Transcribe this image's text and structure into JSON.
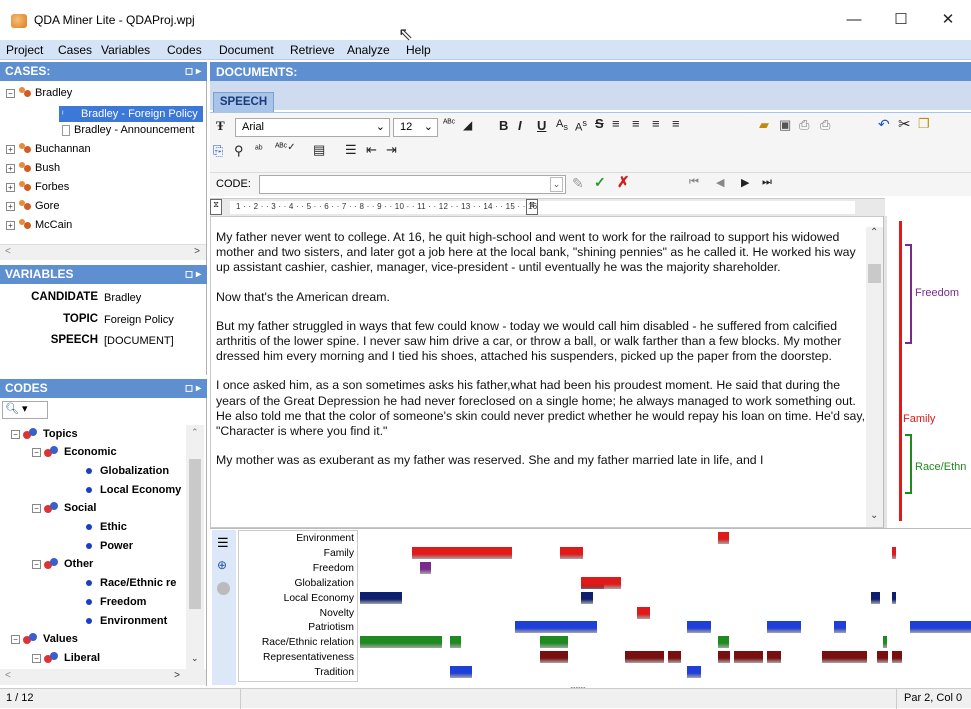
{
  "window": {
    "title": "QDA Miner Lite - QDAProj.wpj",
    "minimize": "—",
    "maximize": "☐",
    "close": "✕"
  },
  "menu": [
    "Project",
    "Cases",
    "Variables",
    "Codes",
    "Document",
    "Retrieve",
    "Analyze",
    "Help"
  ],
  "cases": {
    "header": "CASES:",
    "items": [
      {
        "label": "Bradley",
        "kind": "case",
        "expanded": true
      },
      {
        "label": "Bradley - Foreign Policy",
        "kind": "doc",
        "selected": true
      },
      {
        "label": "Bradley - Announcement",
        "kind": "doc"
      },
      {
        "label": "Buchannan",
        "kind": "case"
      },
      {
        "label": "Bush",
        "kind": "case"
      },
      {
        "label": "Forbes",
        "kind": "case"
      },
      {
        "label": "Gore",
        "kind": "case"
      },
      {
        "label": "McCain",
        "kind": "case"
      }
    ]
  },
  "variables": {
    "header": "VARIABLES",
    "rows": [
      {
        "name": "CANDIDATE",
        "value": "Bradley"
      },
      {
        "name": "TOPIC",
        "value": "Foreign Policy"
      },
      {
        "name": "SPEECH",
        "value": "[DOCUMENT]"
      }
    ]
  },
  "codes": {
    "header": "CODES",
    "tree": [
      {
        "label": "Topics",
        "level": 0,
        "kind": "folder",
        "expander": "⊟"
      },
      {
        "label": "Economic",
        "level": 1,
        "kind": "folder",
        "expander": "⊟"
      },
      {
        "label": "Globalization",
        "level": 2,
        "kind": "code"
      },
      {
        "label": "Local Economy",
        "level": 2,
        "kind": "code"
      },
      {
        "label": "Social",
        "level": 1,
        "kind": "folder",
        "expander": "⊟"
      },
      {
        "label": "Ethic",
        "level": 2,
        "kind": "code"
      },
      {
        "label": "Power",
        "level": 2,
        "kind": "code"
      },
      {
        "label": "Other",
        "level": 1,
        "kind": "folder",
        "expander": "⊟"
      },
      {
        "label": "Race/Ethnic re",
        "level": 2,
        "kind": "code"
      },
      {
        "label": "Freedom",
        "level": 2,
        "kind": "code"
      },
      {
        "label": "Environment",
        "level": 2,
        "kind": "code"
      },
      {
        "label": "Values",
        "level": 0,
        "kind": "folder",
        "expander": "⊟"
      },
      {
        "label": "Liberal",
        "level": 1,
        "kind": "folder",
        "expander": "⊟"
      }
    ]
  },
  "documents": {
    "header": "DOCUMENTS:",
    "tab": "SPEECH",
    "font_name": "Arial",
    "font_size": "12",
    "code_label": "CODE:",
    "ruler": "1 · · 2 · · 3 · · 4 · · 5 · · 6 · · 7 · · 8 · · 9 · · 10 · · 11 · · 12 · · 13 · · 14 · · 15 · · 16",
    "paragraphs": [
      "My father never went to college. At 16, he quit high-school and went to work for the railroad to support his widowed mother and two sisters, and later got a job here at the local bank, \"shining pennies\" as he called it. He worked his way up assistant cashier, cashier, manager, vice-president - until eventually he was the majority shareholder.",
      "Now that's the American dream.",
      "But my father struggled in ways that few could know - today we would call him disabled - he suffered from calcified arthritis of the lower spine. I never saw him drive a car, or throw a ball, or walk farther than a few blocks. My mother dressed him every morning and I tied his shoes, attached his suspenders, picked up the paper from the doorstep.",
      "I once asked him, as a son sometimes asks his father,what had been his proudest moment. He said that during the years of the Great Depression he had never foreclosed on a single home; he always managed to work something out. He also told me that the color of someone's skin could never predict whether he would repay his loan on time. He'd say, \"Character is where you find it.\"",
      "My mother was as exuberant as my father was reserved. She and my father married late in life, and I"
    ]
  },
  "margin_codes": [
    {
      "label": "Freedom",
      "color": "#7a2a8a"
    },
    {
      "label": "Family",
      "color": "#e01919"
    },
    {
      "label": "Race/Ethn",
      "color": "#1f8a1f"
    }
  ],
  "chart_data": {
    "type": "timeline",
    "categories": [
      "Environment",
      "Family",
      "Freedom",
      "Globalization",
      "Local Economy",
      "Novelty",
      "Patriotism",
      "Race/Ethnic relation",
      "Representativeness",
      "Tradition"
    ],
    "colors": {
      "Environment": "#e01919",
      "Family": "#e01919",
      "Freedom": "#7a2a8a",
      "Globalization": "#e01919",
      "Local Economy": "#0d1f6e",
      "Novelty": "#e01919",
      "Patriotism": "#1f3fd9",
      "Race/Ethnic relation": "#1f8a1f",
      "Representativeness": "#7a0f0f",
      "Tradition": "#1f3fd9"
    },
    "segments": [
      {
        "cat": "Environment",
        "start": 0.586,
        "end": 0.604
      },
      {
        "cat": "Family",
        "start": 0.085,
        "end": 0.248
      },
      {
        "cat": "Family",
        "start": 0.328,
        "end": 0.365
      },
      {
        "cat": "Family",
        "start": 0.87,
        "end": 0.877
      },
      {
        "cat": "Freedom",
        "start": 0.099,
        "end": 0.116
      },
      {
        "cat": "Globalization",
        "start": 0.361,
        "end": 0.427
      },
      {
        "cat": "Globalization",
        "start": 0.361,
        "end": 0.4
      },
      {
        "cat": "Local Economy",
        "start": 0.0,
        "end": 0.068
      },
      {
        "cat": "Local Economy",
        "start": 0.361,
        "end": 0.382
      },
      {
        "cat": "Local Economy",
        "start": 0.836,
        "end": 0.851
      },
      {
        "cat": "Local Economy",
        "start": 0.87,
        "end": 0.877
      },
      {
        "cat": "Novelty",
        "start": 0.453,
        "end": 0.475
      },
      {
        "cat": "Patriotism",
        "start": 0.253,
        "end": 0.388
      },
      {
        "cat": "Patriotism",
        "start": 0.535,
        "end": 0.574
      },
      {
        "cat": "Patriotism",
        "start": 0.666,
        "end": 0.721
      },
      {
        "cat": "Patriotism",
        "start": 0.775,
        "end": 0.795
      },
      {
        "cat": "Patriotism",
        "start": 0.9,
        "end": 1.0
      },
      {
        "cat": "Race/Ethnic relation",
        "start": 0.0,
        "end": 0.134
      },
      {
        "cat": "Race/Ethnic relation",
        "start": 0.147,
        "end": 0.166
      },
      {
        "cat": "Race/Ethnic relation",
        "start": 0.294,
        "end": 0.34
      },
      {
        "cat": "Race/Ethnic relation",
        "start": 0.586,
        "end": 0.604
      },
      {
        "cat": "Race/Ethnic relation",
        "start": 0.856,
        "end": 0.863
      },
      {
        "cat": "Representativeness",
        "start": 0.294,
        "end": 0.34
      },
      {
        "cat": "Representativeness",
        "start": 0.433,
        "end": 0.498
      },
      {
        "cat": "Representativeness",
        "start": 0.504,
        "end": 0.525
      },
      {
        "cat": "Representativeness",
        "start": 0.586,
        "end": 0.606
      },
      {
        "cat": "Representativeness",
        "start": 0.612,
        "end": 0.66
      },
      {
        "cat": "Representativeness",
        "start": 0.666,
        "end": 0.689
      },
      {
        "cat": "Representativeness",
        "start": 0.756,
        "end": 0.83
      },
      {
        "cat": "Representativeness",
        "start": 0.846,
        "end": 0.864
      },
      {
        "cat": "Representativeness",
        "start": 0.87,
        "end": 0.887
      },
      {
        "cat": "Tradition",
        "start": 0.147,
        "end": 0.183
      },
      {
        "cat": "Tradition",
        "start": 0.535,
        "end": 0.558
      }
    ]
  },
  "statusbar": {
    "left": "1 / 12",
    "right": "Par 2, Col 0"
  }
}
